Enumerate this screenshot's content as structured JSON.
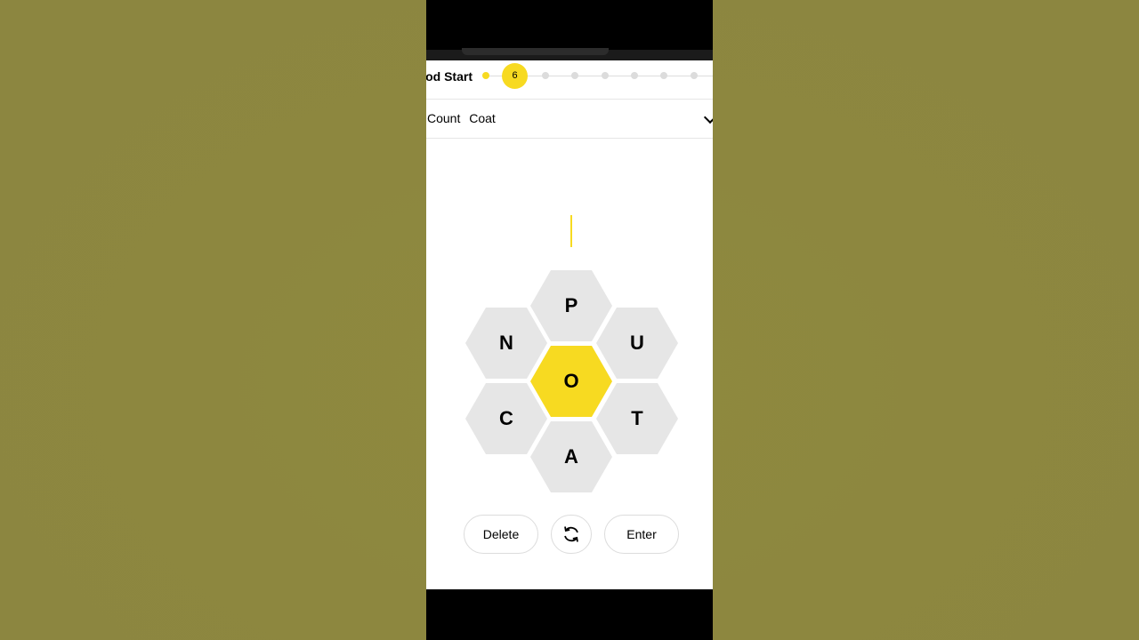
{
  "rank": {
    "label": "Good Start",
    "current_score": "6"
  },
  "words": {
    "found": [
      "Count",
      "Coat"
    ]
  },
  "hive": {
    "center": "O",
    "outer": [
      "P",
      "U",
      "T",
      "A",
      "C",
      "N"
    ]
  },
  "controls": {
    "delete_label": "Delete",
    "enter_label": "Enter"
  },
  "colors": {
    "accent": "#f7da21",
    "cell": "#e6e6e6"
  },
  "icons": {
    "shuffle": "shuffle-icon",
    "expand": "chevron-down-icon"
  }
}
